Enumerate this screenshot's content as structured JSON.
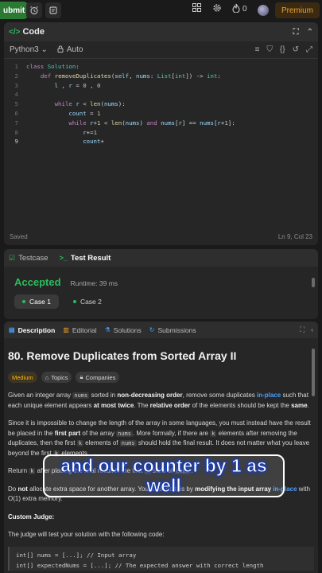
{
  "topbar": {
    "submit_label": "ubmit",
    "streak_count": "0",
    "premium_label": "Premium"
  },
  "code_panel": {
    "title": "Code",
    "language": "Python3",
    "autocomplete": "Auto",
    "status_saved": "Saved",
    "cursor_pos": "Ln 9, Col 23",
    "lines": [
      {
        "n": "1",
        "html": "<span class=\"kw\">class</span> <span class=\"ty\">Solution</span>:"
      },
      {
        "n": "2",
        "html": "    <span class=\"kw\">def</span> <span class=\"fn\">removeDuplicates</span>(<span class=\"vr\">self</span>, <span class=\"vr\">nums</span>: <span class=\"ty\">List</span>[<span class=\"ty\">int</span>]) -&gt; <span class=\"ty\">int</span>:"
      },
      {
        "n": "3",
        "html": "        <span class=\"vr\">l</span> , <span class=\"vr\">r</span> = <span class=\"nm\">0</span> , <span class=\"nm\">0</span>"
      },
      {
        "n": "4",
        "html": ""
      },
      {
        "n": "5",
        "html": "        <span class=\"kw\">while</span> <span class=\"vr\">r</span> &lt; <span class=\"fn\">len</span>(<span class=\"vr\">nums</span>):"
      },
      {
        "n": "6",
        "html": "            <span class=\"vr\">count</span> = <span class=\"nm\">1</span>"
      },
      {
        "n": "7",
        "html": "            <span class=\"kw\">while</span> <span class=\"vr\">r</span>+<span class=\"nm\">1</span> &lt; <span class=\"fn\">len</span>(<span class=\"vr\">nums</span>) <span class=\"kw\">and</span> <span class=\"vr\">nums</span>[<span class=\"vr\">r</span>] == <span class=\"vr\">nums</span>[<span class=\"vr\">r</span>+<span class=\"nm\">1</span>]:"
      },
      {
        "n": "8",
        "html": "                <span class=\"vr\">r</span>+=<span class=\"nm\">1</span>"
      },
      {
        "n": "9",
        "html": "                <span class=\"vr\">count</span>+"
      }
    ]
  },
  "result_panel": {
    "tab_testcase": "Testcase",
    "tab_result": "Test Result",
    "verdict": "Accepted",
    "runtime": "Runtime: 39 ms",
    "case1": "Case 1",
    "case2": "Case 2"
  },
  "description": {
    "tab_description": "Description",
    "tab_editorial": "Editorial",
    "tab_solutions": "Solutions",
    "tab_submissions": "Submissions",
    "title": "80. Remove Duplicates from Sorted Array II",
    "tag_difficulty": "Medium",
    "tag_topics": "Topics",
    "tag_companies": "Companies",
    "p1_html": "Given an integer array <span class=\"code-inline\">nums</span> sorted in <b>non-decreasing order</b>, remove some duplicates <span class=\"link\">in-place</span> such that each unique element appears <b>at most twice</b>. The <b>relative order</b> of the elements should be kept the <b>same</b>.",
    "p2_html": "Since it is impossible to change the length of the array in some languages, you must instead have the result be placed in the <b>first part</b> of the array <span class=\"code-inline\">nums</span>. More formally, if there are <span class=\"code-inline\">k</span> elements after removing the duplicates, then the first <span class=\"code-inline\">k</span> elements of <span class=\"code-inline\">nums</span> should hold the final result. It does not matter what you leave beyond the first <span class=\"code-inline\">k</span> elements.",
    "p3_html": "Return <span class=\"code-inline\">k</span> after placing the final result in the first <span class=\"code-inline\">k</span> slots of <span class=\"code-inline\">nums</span>.",
    "p4_html": "Do <b>not</b> allocate extra space for another array. You must do this by <b>modifying the input array</b> <span class=\"link\">in-place</span> with O(1) extra memory.",
    "custom_judge_heading": "Custom Judge:",
    "p5": "The judge will test your solution with the following code:",
    "code_block": "int[] nums = [...]; // Input array\nint[] expectedNums = [...]; // The expected answer with correct length"
  },
  "caption": "and our counter by 1 as well",
  "colors": {
    "accent_green": "#2cbb5d",
    "premium_orange": "#f0a030",
    "medium_yellow": "#ffb800",
    "link_blue": "#4a9fff"
  }
}
